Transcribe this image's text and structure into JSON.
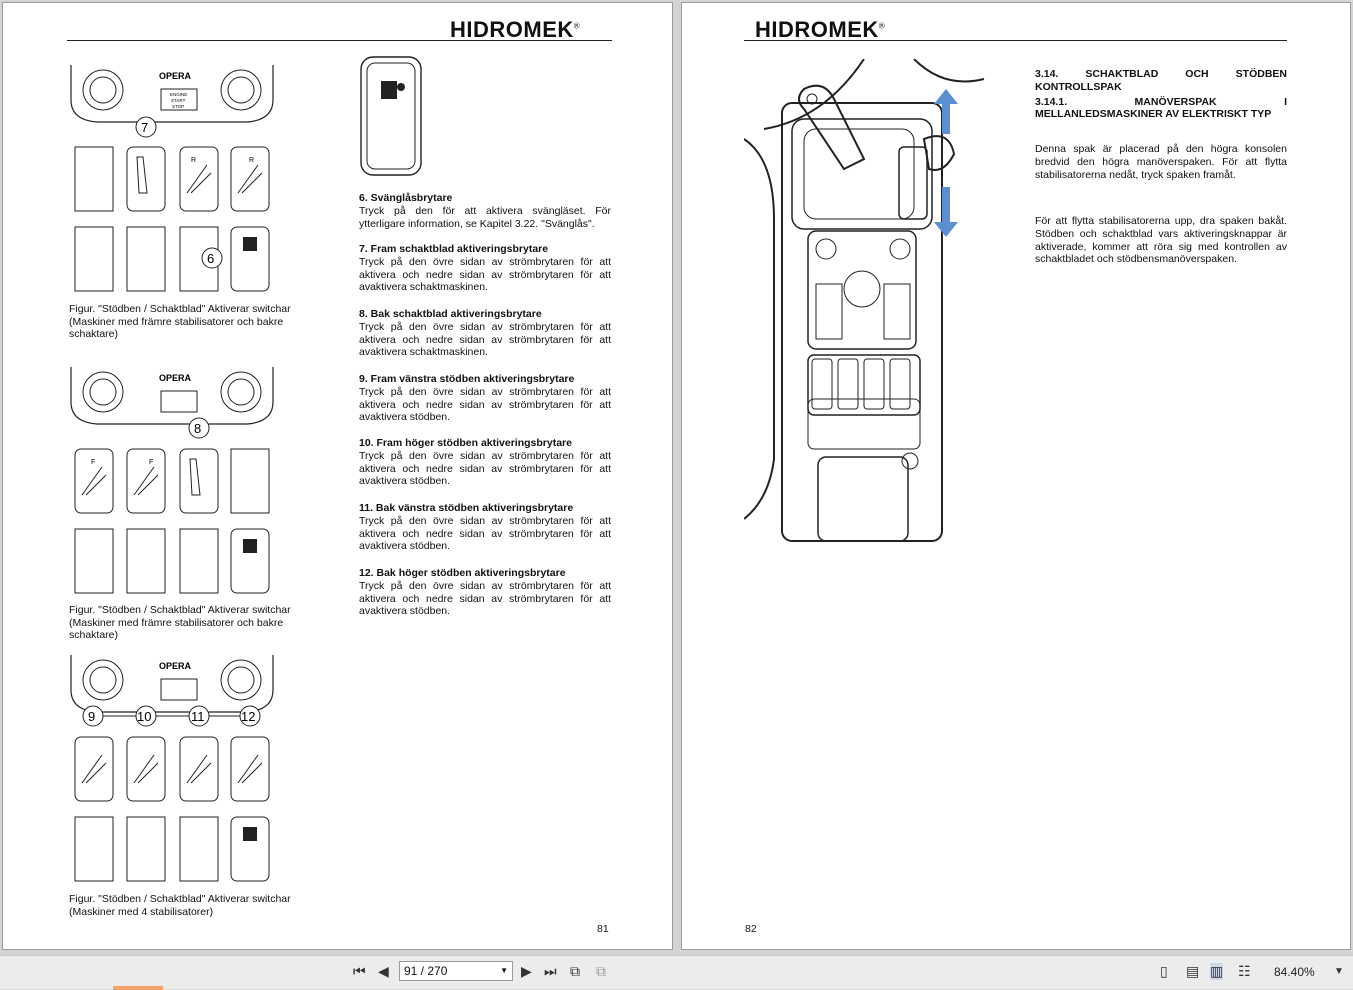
{
  "brand": "HIDROMEK",
  "left_page": {
    "figures": [
      {
        "callouts": [
          "7",
          "6"
        ],
        "caption": [
          "Figur. \"Stödben / Schaktblad\" Aktiverar switchar",
          "(Maskiner med främre stabilisatorer och bakre",
          "schaktare)"
        ]
      },
      {
        "callouts": [
          "8"
        ],
        "caption": [
          "Figur. \"Stödben / Schaktblad\" Aktiverar switchar",
          "(Maskiner med främre stabilisatorer och bakre",
          "schaktare)"
        ]
      },
      {
        "callouts": [
          "9",
          "10",
          "11",
          "12"
        ],
        "caption": [
          "Figur. \"Stödben / Schaktblad\" Aktiverar switchar",
          "(Maskiner med 4 stabilisatorer)"
        ]
      }
    ],
    "panel_labels": {
      "brand": "OPERA",
      "engine": "ENGINE",
      "start": "START",
      "stop": "STOP",
      "f": "F",
      "r": "R"
    },
    "sections": [
      {
        "title": "6. Svänglåsbrytare",
        "body": "Tryck på den för att aktivera svängläset. För ytterligare information, se Kapitel 3.22. \"Svänglås\"."
      },
      {
        "title": "7. Fram schaktblad aktiveringsbrytare",
        "body": "Tryck på den övre sidan av strömbrytaren för att aktivera och nedre sidan av strömbrytaren för att avaktivera schaktmaskinen."
      },
      {
        "title": "8. Bak schaktblad aktiveringsbrytare",
        "body": "Tryck på den övre sidan av strömbrytaren för att aktivera och nedre sidan av strömbrytaren för att avaktivera schaktmaskinen."
      },
      {
        "title": "9. Fram vänstra stödben aktiveringsbrytare",
        "body": "Tryck på den övre sidan av strömbrytaren för att aktivera och nedre sidan av strömbrytaren för att avaktivera stödben."
      },
      {
        "title": "10. Fram höger stödben aktiveringsbrytare",
        "body": "Tryck på den övre sidan av strömbrytaren för att aktivera och nedre sidan av strömbrytaren för att avaktivera stödben."
      },
      {
        "title": "11. Bak vänstra stödben aktiveringsbrytare",
        "body": "Tryck på den övre sidan av strömbrytaren för att aktivera och nedre sidan av strömbrytaren för att avaktivera stödben."
      },
      {
        "title": "12. Bak höger stödben aktiveringsbrytare",
        "body": "Tryck på den övre sidan av strömbrytaren för att aktivera och nedre sidan av strömbrytaren för att avaktivera stödben."
      }
    ],
    "page_number": "81"
  },
  "right_page": {
    "heading1": "3.14. SCHAKTBLAD OCH STÖDBEN KONTROLLSPAK",
    "heading2": "3.14.1. MANÖVERSPAK I MELLANLEDSMASKINER AV ELEKTRISKT TYP",
    "para1": "Denna spak är placerad på den högra konsolen bredvid den högra manöverspaken. För att flytta stabilisatorerna nedåt, tryck spaken framåt.",
    "para2": "För att flytta stabilisatorerna upp, dra spaken bakåt. Stödben och schaktblad vars aktiveringsknappar är aktiverade, kommer att röra sig med kontrollen av schaktbladet och stödbensmanöverspaken.",
    "page_number": "82"
  },
  "toolbar": {
    "first_icon": "first-page-icon",
    "prev_icon": "prev-page-icon",
    "page_field": "91 / 270",
    "next_icon": "next-page-icon",
    "last_icon": "last-page-icon",
    "zoom": "84.40%",
    "accent_color": "#f2a46a"
  }
}
